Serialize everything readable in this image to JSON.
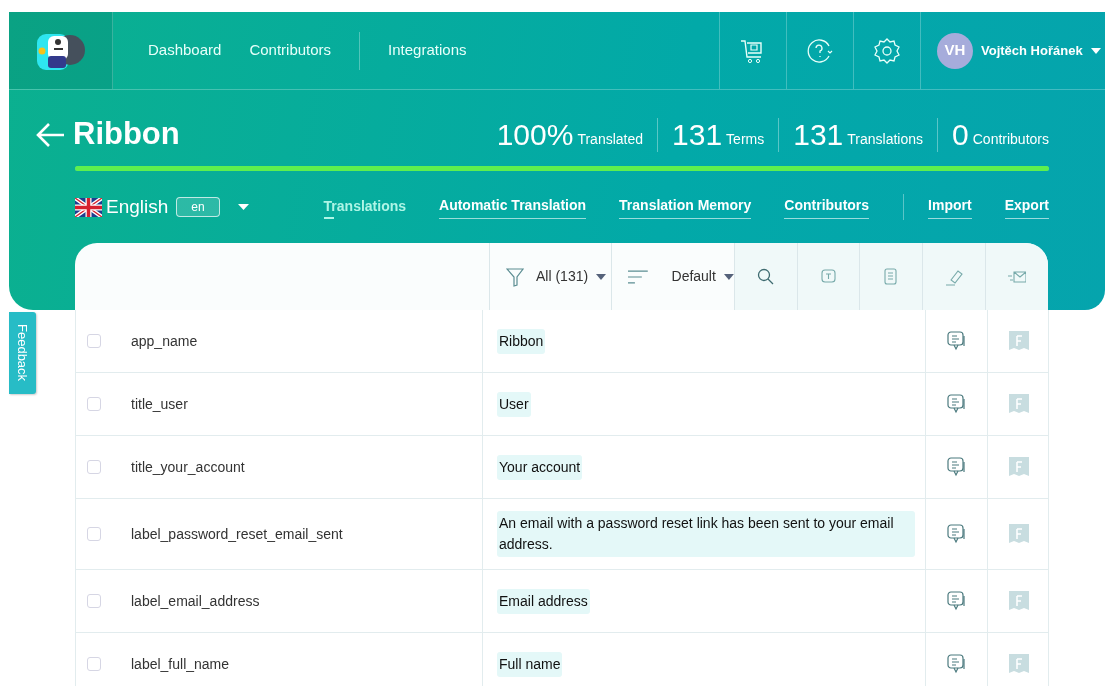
{
  "nav": {
    "links": [
      {
        "label": "Dashboard"
      },
      {
        "label": "Contributors"
      },
      {
        "label": "Integrations"
      }
    ],
    "user": {
      "initials": "VH",
      "name": "Vojtěch Hořánek"
    }
  },
  "project": {
    "title": "Ribbon",
    "stats": [
      {
        "value": "100%",
        "label": "Translated"
      },
      {
        "value": "131",
        "label": "Terms"
      },
      {
        "value": "131",
        "label": "Translations"
      },
      {
        "value": "0",
        "label": "Contributors"
      }
    ],
    "progress": {
      "level": 1
    }
  },
  "language": {
    "name": "English",
    "code": "en"
  },
  "tabs": [
    {
      "label": "Translations",
      "selected": true
    },
    {
      "label": "Automatic Translation",
      "selected": false
    },
    {
      "label": "Translation Memory",
      "selected": false
    },
    {
      "label": "Contributors",
      "selected": false
    }
  ],
  "actions": [
    {
      "label": "Import"
    },
    {
      "label": "Export"
    }
  ],
  "toolbar": {
    "filter": "All (131)",
    "sort": "Default"
  },
  "rows": [
    {
      "key": "app_name",
      "translation": "Ribbon",
      "checked": false
    },
    {
      "key": "title_user",
      "translation": "User",
      "checked": false
    },
    {
      "key": "title_your_account",
      "translation": "Your account",
      "checked": false
    },
    {
      "key": "label_password_reset_email_sent",
      "translation": "An email with a password reset link has been sent to your email address.",
      "checked": false
    },
    {
      "key": "label_email_address",
      "translation": "Email address",
      "checked": false
    },
    {
      "key": "label_full_name",
      "translation": "Full name",
      "checked": false
    }
  ],
  "feedback": {
    "label": "Feedback"
  }
}
